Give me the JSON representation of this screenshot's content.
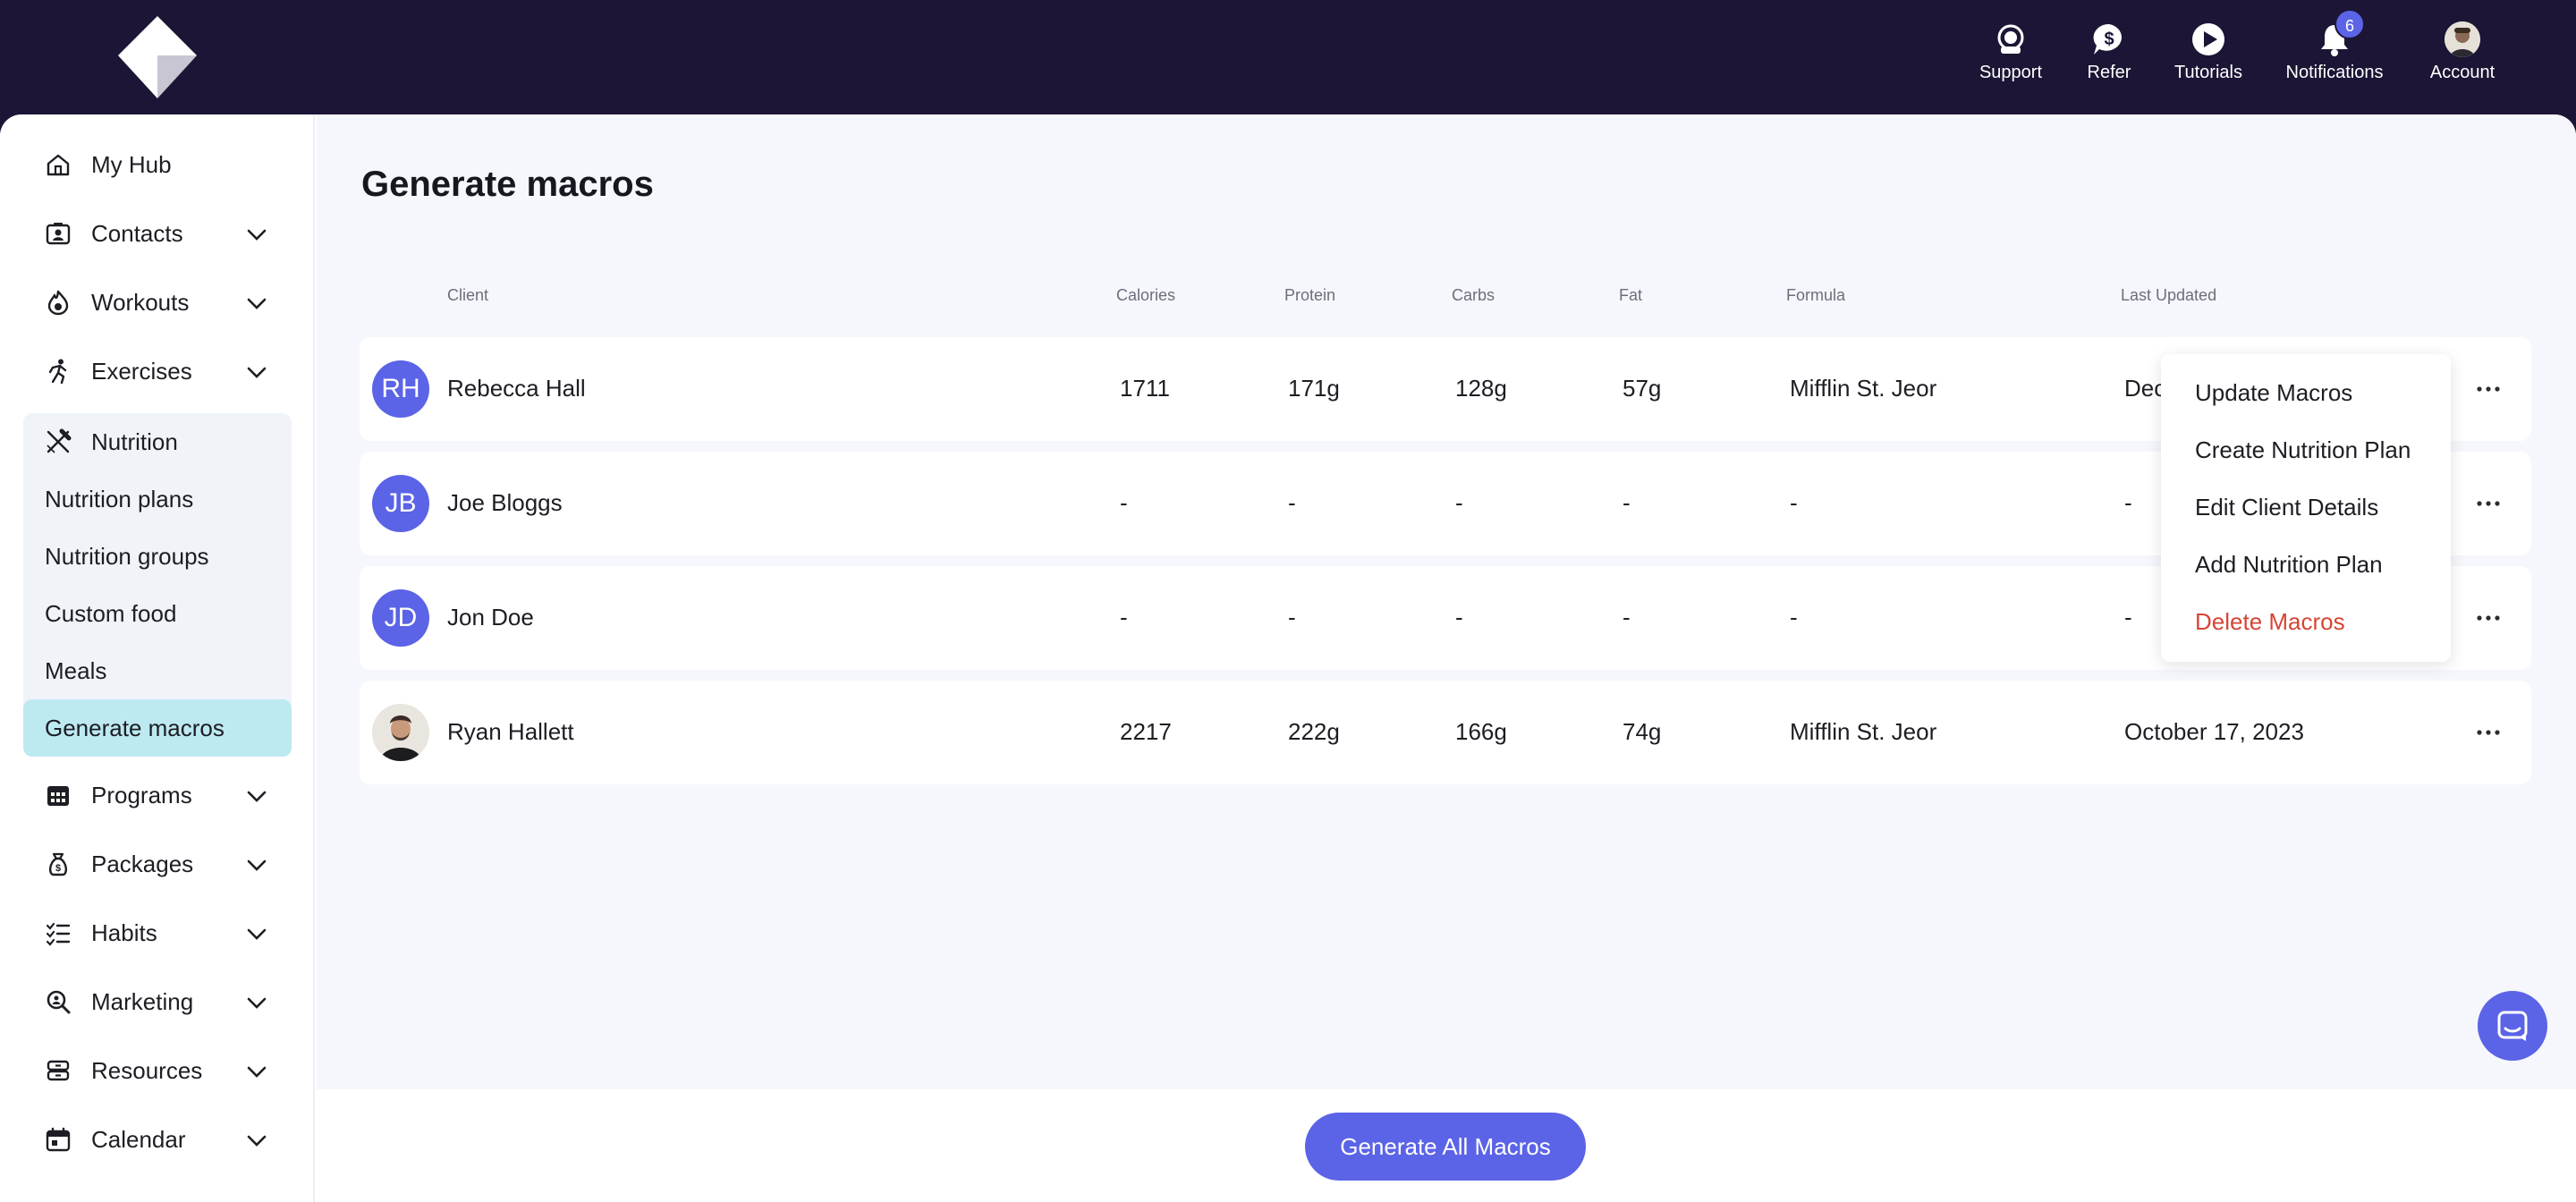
{
  "topnav": {
    "items": [
      {
        "label": "Support",
        "icon": "support-icon"
      },
      {
        "label": "Refer",
        "icon": "refer-dollar-icon"
      },
      {
        "label": "Tutorials",
        "icon": "play-icon"
      },
      {
        "label": "Notifications",
        "icon": "bell-icon",
        "badge": "6"
      },
      {
        "label": "Account",
        "icon": "account-avatar"
      }
    ]
  },
  "sidebar": {
    "items": [
      {
        "label": "My Hub",
        "icon": "home-icon"
      },
      {
        "label": "Contacts",
        "icon": "contacts-icon"
      },
      {
        "label": "Workouts",
        "icon": "workouts-icon"
      },
      {
        "label": "Exercises",
        "icon": "exercises-icon"
      },
      {
        "label": "Nutrition",
        "icon": "fork-knife-icon"
      },
      {
        "label": "Programs",
        "icon": "calendar-grid-icon"
      },
      {
        "label": "Packages",
        "icon": "money-bag-icon"
      },
      {
        "label": "Habits",
        "icon": "checklist-icon"
      },
      {
        "label": "Marketing",
        "icon": "magnify-icon"
      },
      {
        "label": "Resources",
        "icon": "stack-icon"
      },
      {
        "label": "Calendar",
        "icon": "calendar-icon"
      }
    ],
    "nutrition_sub": [
      {
        "label": "Nutrition plans"
      },
      {
        "label": "Nutrition groups"
      },
      {
        "label": "Custom food"
      },
      {
        "label": "Meals"
      },
      {
        "label": "Generate macros",
        "active": true
      }
    ]
  },
  "main": {
    "title": "Generate macros",
    "columns": [
      "Client",
      "Calories",
      "Protein",
      "Carbs",
      "Fat",
      "Formula",
      "Last Updated"
    ],
    "rows": [
      {
        "initials": "RH",
        "name": "Rebecca Hall",
        "calories": "1711",
        "protein": "171g",
        "carbs": "128g",
        "fat": "57g",
        "formula": "Mifflin St. Jeor",
        "updated": "Dec"
      },
      {
        "initials": "JB",
        "name": "Joe Bloggs",
        "calories": "-",
        "protein": "-",
        "carbs": "-",
        "fat": "-",
        "formula": "-",
        "updated": "-"
      },
      {
        "initials": "JD",
        "name": "Jon Doe",
        "calories": "-",
        "protein": "-",
        "carbs": "-",
        "fat": "-",
        "formula": "-",
        "updated": "-"
      },
      {
        "initials": "",
        "name": "Ryan Hallett",
        "calories": "2217",
        "protein": "222g",
        "carbs": "166g",
        "fat": "74g",
        "formula": "Mifflin St. Jeor",
        "updated": "October 17, 2023"
      }
    ]
  },
  "menu": {
    "items": [
      "Update Macros",
      "Create Nutrition Plan",
      "Edit Client Details",
      "Add Nutrition Plan"
    ],
    "danger": "Delete Macros"
  },
  "bottom": {
    "generate_label": "Generate All Macros"
  },
  "colors": {
    "accent": "#5b63e6",
    "nav_bg": "#1c1535",
    "active_bg": "#bde9f1",
    "danger": "#d64535"
  }
}
